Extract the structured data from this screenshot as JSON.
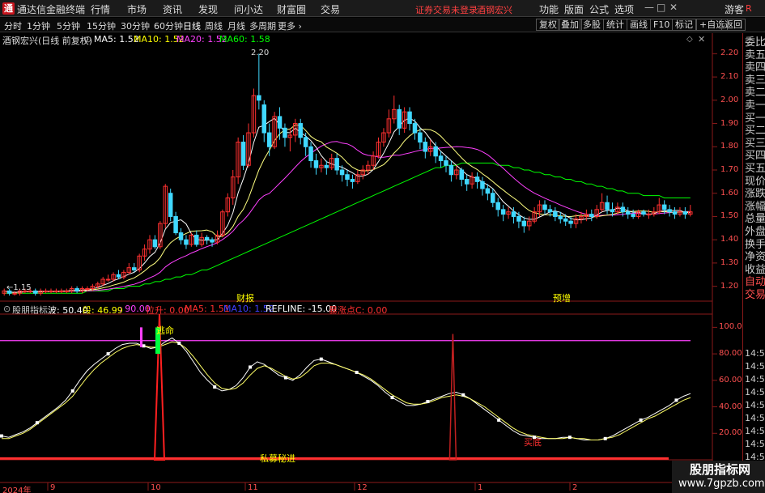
{
  "app": {
    "logo": "通",
    "title": "通达信金融终端"
  },
  "menu": [
    "行情",
    "市场",
    "资讯",
    "发现",
    "问小达",
    "财富圈",
    "交易"
  ],
  "status": {
    "trade": "证券交易未登录",
    "stock": "酒钢宏兴"
  },
  "right_menu": [
    "功能",
    "版面",
    "公式",
    "选项",
    "游客"
  ],
  "window_controls": [
    "—",
    "□",
    "✕"
  ],
  "periods": [
    "分时",
    "1分钟",
    "5分钟",
    "15分钟",
    "30分钟",
    "60分钟",
    "日线",
    "周线",
    "月线",
    "多周期",
    "更多 ›"
  ],
  "active_period": "日线",
  "toolbar_buttons": [
    "复权",
    "叠加",
    "多股",
    "统计",
    "画线",
    "F10",
    "标记",
    "+自选",
    "返回"
  ],
  "stock_label": "酒钢宏兴(日线 前复权)",
  "ma_legend": [
    {
      "label": "MA5: 1.52",
      "color": "#ffffff"
    },
    {
      "label": "MA10: 1.52",
      "color": "#ffff00"
    },
    {
      "label": "MA20: 1.52",
      "color": "#ff40ff"
    },
    {
      "label": "MA60: 1.58",
      "color": "#00ff00"
    }
  ],
  "price_axis": [
    "2.20",
    "2.10",
    "2.00",
    "1.90",
    "1.80",
    "1.70",
    "1.60",
    "1.50",
    "1.40",
    "1.30",
    "1.20"
  ],
  "price_annotations": {
    "high": "2.20",
    "low": "1.15"
  },
  "event_labels": [
    "财报",
    "预增"
  ],
  "indicator_legend": [
    {
      "label": "股朋指标",
      "color": "#cccccc"
    },
    {
      "label": "波: 50.40",
      "color": "#ffffff"
    },
    {
      "label": "段: 46.99",
      "color": "#ffff00"
    },
    {
      "label": ": 90.00",
      "color": "#ff40ff"
    },
    {
      "label": "拉升: 0.00",
      "color": "#ff3030"
    },
    {
      "label": "MA5: 1.51",
      "color": "#ff3030"
    },
    {
      "label": "MA10: 1.52",
      "color": "#4040ff"
    },
    {
      "label": "REFLINE: -15.00",
      "color": "#ffffff"
    },
    {
      "label": "暴涨点C: 0.00",
      "color": "#ff3030"
    }
  ],
  "indicator_axis": [
    "100.0",
    "80.00",
    "60.00",
    "40.00",
    "20.00"
  ],
  "indicator_labels": {
    "escape": "逃命",
    "bottom": "买底",
    "text": "私募秘进"
  },
  "x_axis": [
    "2024年",
    "9",
    "10",
    "11",
    "12",
    "1",
    "2"
  ],
  "sidebar": [
    "委比",
    "卖五",
    "卖四",
    "卖三",
    "卖二",
    "卖一",
    "买一",
    "买二",
    "买三",
    "买四",
    "买五",
    "现价",
    "涨跌",
    "涨幅",
    "总量",
    "外盘",
    "换手",
    "净资",
    "收益",
    "自动",
    "交易"
  ],
  "times": [
    "14:56",
    "14:56",
    "14:56",
    "14:56",
    "14:56",
    "14:56",
    "14:56",
    "14:56",
    "14:56"
  ],
  "watermark": {
    "title": "股朋指标网",
    "url": "www.7gpzb.com"
  },
  "chart_data": {
    "type": "candlestick",
    "price_ylim": [
      1.15,
      2.25
    ],
    "candles": [
      [
        1.17,
        1.18,
        1.19,
        1.16
      ],
      [
        1.18,
        1.17,
        1.19,
        1.16
      ],
      [
        1.17,
        1.17,
        1.18,
        1.16
      ],
      [
        1.17,
        1.18,
        1.19,
        1.16
      ],
      [
        1.18,
        1.18,
        1.19,
        1.17
      ],
      [
        1.18,
        1.18,
        1.19,
        1.17
      ],
      [
        1.18,
        1.17,
        1.19,
        1.16
      ],
      [
        1.17,
        1.18,
        1.19,
        1.16
      ],
      [
        1.18,
        1.18,
        1.19,
        1.17
      ],
      [
        1.18,
        1.18,
        1.19,
        1.17
      ],
      [
        1.18,
        1.18,
        1.19,
        1.17
      ],
      [
        1.18,
        1.18,
        1.19,
        1.17
      ],
      [
        1.18,
        1.18,
        1.19,
        1.17
      ],
      [
        1.18,
        1.19,
        1.2,
        1.17
      ],
      [
        1.19,
        1.18,
        1.2,
        1.17
      ],
      [
        1.18,
        1.19,
        1.2,
        1.17
      ],
      [
        1.19,
        1.19,
        1.2,
        1.18
      ],
      [
        1.19,
        1.2,
        1.21,
        1.18
      ],
      [
        1.2,
        1.21,
        1.22,
        1.19
      ],
      [
        1.21,
        1.23,
        1.24,
        1.2
      ],
      [
        1.23,
        1.23,
        1.25,
        1.22
      ],
      [
        1.23,
        1.25,
        1.26,
        1.22
      ],
      [
        1.25,
        1.24,
        1.27,
        1.23
      ],
      [
        1.24,
        1.26,
        1.27,
        1.23
      ],
      [
        1.26,
        1.28,
        1.3,
        1.25
      ],
      [
        1.28,
        1.27,
        1.3,
        1.26
      ],
      [
        1.27,
        1.33,
        1.34,
        1.26
      ],
      [
        1.33,
        1.36,
        1.38,
        1.31
      ],
      [
        1.36,
        1.4,
        1.42,
        1.34
      ],
      [
        1.4,
        1.37,
        1.42,
        1.36
      ],
      [
        1.37,
        1.47,
        1.48,
        1.36
      ],
      [
        1.47,
        1.63,
        1.64,
        1.45
      ],
      [
        1.6,
        1.5,
        1.62,
        1.48
      ],
      [
        1.5,
        1.43,
        1.52,
        1.42
      ],
      [
        1.43,
        1.4,
        1.45,
        1.38
      ],
      [
        1.4,
        1.38,
        1.42,
        1.36
      ],
      [
        1.38,
        1.42,
        1.43,
        1.37
      ],
      [
        1.42,
        1.38,
        1.44,
        1.37
      ],
      [
        1.38,
        1.41,
        1.43,
        1.37
      ],
      [
        1.41,
        1.4,
        1.42,
        1.38
      ],
      [
        1.4,
        1.39,
        1.41,
        1.37
      ],
      [
        1.39,
        1.42,
        1.44,
        1.38
      ],
      [
        1.42,
        1.52,
        1.53,
        1.41
      ],
      [
        1.52,
        1.58,
        1.6,
        1.5
      ],
      [
        1.58,
        1.67,
        1.7,
        1.55
      ],
      [
        1.67,
        1.82,
        1.84,
        1.64
      ],
      [
        1.82,
        1.72,
        1.85,
        1.7
      ],
      [
        1.72,
        1.86,
        1.9,
        1.71
      ],
      [
        1.86,
        2.02,
        2.05,
        1.84
      ],
      [
        2.02,
        2.0,
        2.2,
        1.96
      ],
      [
        1.98,
        1.86,
        2.0,
        1.82
      ],
      [
        1.86,
        1.8,
        1.9,
        1.76
      ],
      [
        1.8,
        1.93,
        1.95,
        1.79
      ],
      [
        1.93,
        1.88,
        1.97,
        1.83
      ],
      [
        1.88,
        1.84,
        1.9,
        1.8
      ],
      [
        1.84,
        1.85,
        1.88,
        1.78
      ],
      [
        1.85,
        1.9,
        1.92,
        1.82
      ],
      [
        1.9,
        1.84,
        1.92,
        1.81
      ],
      [
        1.84,
        1.8,
        1.86,
        1.76
      ],
      [
        1.8,
        1.74,
        1.82,
        1.71
      ],
      [
        1.74,
        1.71,
        1.77,
        1.68
      ],
      [
        1.71,
        1.72,
        1.75,
        1.69
      ],
      [
        1.72,
        1.71,
        1.74,
        1.68
      ],
      [
        1.71,
        1.75,
        1.77,
        1.7
      ],
      [
        1.75,
        1.7,
        1.77,
        1.68
      ],
      [
        1.7,
        1.68,
        1.72,
        1.65
      ],
      [
        1.68,
        1.66,
        1.7,
        1.63
      ],
      [
        1.66,
        1.65,
        1.68,
        1.62
      ],
      [
        1.65,
        1.68,
        1.7,
        1.64
      ],
      [
        1.68,
        1.7,
        1.72,
        1.66
      ],
      [
        1.7,
        1.72,
        1.74,
        1.68
      ],
      [
        1.72,
        1.76,
        1.78,
        1.7
      ],
      [
        1.76,
        1.82,
        1.84,
        1.75
      ],
      [
        1.82,
        1.86,
        1.88,
        1.8
      ],
      [
        1.86,
        1.92,
        1.96,
        1.84
      ],
      [
        1.92,
        1.96,
        2.02,
        1.9
      ],
      [
        1.96,
        1.88,
        1.98,
        1.85
      ],
      [
        1.88,
        1.95,
        1.97,
        1.86
      ],
      [
        1.95,
        1.9,
        1.97,
        1.87
      ],
      [
        1.9,
        1.86,
        1.92,
        1.83
      ],
      [
        1.86,
        1.82,
        1.88,
        1.79
      ],
      [
        1.82,
        1.78,
        1.84,
        1.75
      ],
      [
        1.78,
        1.8,
        1.83,
        1.76
      ],
      [
        1.8,
        1.76,
        1.82,
        1.73
      ],
      [
        1.76,
        1.74,
        1.78,
        1.71
      ],
      [
        1.74,
        1.72,
        1.76,
        1.69
      ],
      [
        1.72,
        1.68,
        1.74,
        1.65
      ],
      [
        1.68,
        1.7,
        1.72,
        1.66
      ],
      [
        1.7,
        1.66,
        1.71,
        1.63
      ],
      [
        1.66,
        1.64,
        1.68,
        1.61
      ],
      [
        1.64,
        1.67,
        1.69,
        1.62
      ],
      [
        1.67,
        1.65,
        1.69,
        1.62
      ],
      [
        1.65,
        1.62,
        1.67,
        1.59
      ],
      [
        1.62,
        1.6,
        1.64,
        1.57
      ],
      [
        1.6,
        1.56,
        1.62,
        1.54
      ],
      [
        1.56,
        1.53,
        1.58,
        1.5
      ],
      [
        1.53,
        1.51,
        1.55,
        1.48
      ],
      [
        1.51,
        1.52,
        1.54,
        1.49
      ],
      [
        1.52,
        1.5,
        1.54,
        1.47
      ],
      [
        1.5,
        1.48,
        1.52,
        1.45
      ],
      [
        1.48,
        1.46,
        1.5,
        1.43
      ],
      [
        1.46,
        1.48,
        1.5,
        1.44
      ],
      [
        1.48,
        1.52,
        1.54,
        1.47
      ],
      [
        1.52,
        1.55,
        1.57,
        1.5
      ],
      [
        1.55,
        1.53,
        1.57,
        1.51
      ],
      [
        1.53,
        1.52,
        1.55,
        1.5
      ],
      [
        1.52,
        1.5,
        1.54,
        1.48
      ],
      [
        1.5,
        1.49,
        1.52,
        1.47
      ],
      [
        1.49,
        1.48,
        1.51,
        1.46
      ],
      [
        1.48,
        1.47,
        1.5,
        1.45
      ],
      [
        1.47,
        1.49,
        1.51,
        1.45
      ],
      [
        1.49,
        1.5,
        1.52,
        1.47
      ],
      [
        1.5,
        1.51,
        1.53,
        1.48
      ],
      [
        1.51,
        1.5,
        1.53,
        1.48
      ],
      [
        1.5,
        1.53,
        1.55,
        1.49
      ],
      [
        1.53,
        1.56,
        1.6,
        1.52
      ],
      [
        1.56,
        1.53,
        1.59,
        1.51
      ],
      [
        1.53,
        1.52,
        1.56,
        1.5
      ],
      [
        1.52,
        1.54,
        1.56,
        1.51
      ],
      [
        1.54,
        1.52,
        1.56,
        1.5
      ],
      [
        1.52,
        1.51,
        1.54,
        1.49
      ],
      [
        1.51,
        1.5,
        1.53,
        1.49
      ],
      [
        1.5,
        1.52,
        1.53,
        1.49
      ],
      [
        1.52,
        1.51,
        1.53,
        1.5
      ],
      [
        1.51,
        1.51,
        1.53,
        1.49
      ],
      [
        1.51,
        1.52,
        1.54,
        1.5
      ],
      [
        1.52,
        1.55,
        1.58,
        1.51
      ],
      [
        1.55,
        1.53,
        1.57,
        1.51
      ],
      [
        1.53,
        1.52,
        1.55,
        1.5
      ],
      [
        1.52,
        1.51,
        1.54,
        1.49
      ],
      [
        1.51,
        1.52,
        1.54,
        1.5
      ],
      [
        1.52,
        1.51,
        1.54,
        1.49
      ],
      [
        1.51,
        1.52,
        1.55,
        1.5
      ]
    ],
    "ma60": [
      1.17,
      1.17,
      1.17,
      1.17,
      1.17,
      1.17,
      1.17,
      1.17,
      1.17,
      1.17,
      1.17,
      1.17,
      1.17,
      1.17,
      1.17,
      1.17,
      1.18,
      1.18,
      1.18,
      1.18,
      1.18,
      1.19,
      1.19,
      1.19,
      1.2,
      1.2,
      1.2,
      1.21,
      1.21,
      1.22,
      1.22,
      1.23,
      1.23,
      1.24,
      1.24,
      1.25,
      1.25,
      1.26,
      1.27,
      1.27,
      1.28,
      1.29,
      1.3,
      1.31,
      1.32,
      1.33,
      1.34,
      1.35,
      1.36,
      1.37,
      1.38,
      1.39,
      1.4,
      1.41,
      1.42,
      1.43,
      1.44,
      1.45,
      1.46,
      1.47,
      1.48,
      1.49,
      1.5,
      1.51,
      1.52,
      1.53,
      1.54,
      1.55,
      1.56,
      1.57,
      1.58,
      1.59,
      1.6,
      1.61,
      1.62,
      1.63,
      1.64,
      1.65,
      1.66,
      1.67,
      1.68,
      1.69,
      1.7,
      1.71,
      1.71,
      1.72,
      1.72,
      1.72,
      1.73,
      1.73,
      1.73,
      1.73,
      1.73,
      1.73,
      1.73,
      1.72,
      1.72,
      1.72,
      1.71,
      1.71,
      1.7,
      1.7,
      1.69,
      1.69,
      1.68,
      1.68,
      1.67,
      1.67,
      1.66,
      1.66,
      1.65,
      1.65,
      1.64,
      1.64,
      1.63,
      1.63,
      1.62,
      1.62,
      1.61,
      1.61,
      1.6,
      1.6,
      1.6,
      1.59,
      1.59,
      1.59,
      1.59,
      1.58,
      1.58,
      1.58,
      1.58,
      1.58,
      1.58
    ],
    "oscillator_ylim": [
      0,
      110
    ],
    "wave": [
      18,
      17,
      19,
      21,
      24,
      28,
      32,
      36,
      40,
      45,
      52,
      60,
      67,
      72,
      76,
      80,
      84,
      87,
      88,
      88,
      86,
      84,
      85,
      89,
      92,
      88,
      82,
      74,
      66,
      60,
      55,
      52,
      53,
      56,
      62,
      70,
      74,
      72,
      68,
      64,
      62,
      60,
      64,
      70,
      75,
      76,
      74,
      72,
      70,
      68,
      66,
      63,
      60,
      56,
      51,
      47,
      44,
      41,
      41,
      42,
      44,
      46,
      48,
      50,
      51,
      49,
      46,
      42,
      38,
      34,
      30,
      26,
      22,
      19,
      18,
      17,
      16,
      16,
      16,
      17,
      17,
      16,
      15,
      15,
      15,
      16,
      18,
      21,
      24,
      27,
      30,
      32,
      35,
      38,
      41,
      45,
      48,
      50
    ],
    "segment": [
      16,
      16,
      18,
      20,
      23,
      27,
      31,
      35,
      39,
      43,
      48,
      55,
      62,
      68,
      73,
      77,
      81,
      84,
      86,
      87,
      86,
      85,
      85,
      87,
      89,
      88,
      84,
      78,
      71,
      64,
      58,
      54,
      53,
      54,
      58,
      64,
      69,
      71,
      69,
      66,
      63,
      61,
      62,
      66,
      71,
      73,
      73,
      72,
      70,
      68,
      66,
      64,
      61,
      57,
      53,
      49,
      46,
      43,
      42,
      42,
      43,
      45,
      47,
      48,
      49,
      48,
      46,
      43,
      40,
      36,
      32,
      28,
      24,
      21,
      19,
      18,
      17,
      16,
      16,
      16,
      17,
      16,
      16,
      15,
      15,
      16,
      17,
      19,
      22,
      25,
      28,
      31,
      33,
      36,
      39,
      42,
      45,
      47
    ],
    "refline_90": 90,
    "spikes": [
      {
        "index": 28,
        "value": 110
      },
      {
        "index": 86,
        "value": 95
      }
    ]
  }
}
